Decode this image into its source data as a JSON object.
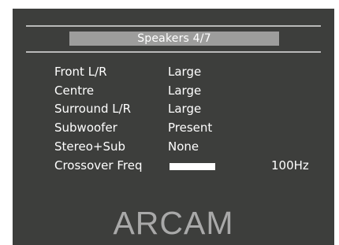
{
  "menu": {
    "title": "Speakers 4/7"
  },
  "settings": [
    {
      "label": "Front L/R",
      "value": "Large"
    },
    {
      "label": "Centre",
      "value": "Large"
    },
    {
      "label": "Surround L/R",
      "value": "Large"
    },
    {
      "label": "Subwoofer",
      "value": "Present"
    },
    {
      "label": "Stereo+Sub",
      "value": "None"
    }
  ],
  "crossover": {
    "label": "Crossover Freq",
    "value": "100Hz",
    "bar_level": 1.0
  },
  "brand": {
    "logo_text": "ARCAM"
  },
  "colors": {
    "screen_background": "#3d3e3c",
    "title_bar": "#9d9d9c",
    "text": "#ffffff",
    "logo": "#a9a9a9",
    "rules": "#b9b9b9"
  }
}
